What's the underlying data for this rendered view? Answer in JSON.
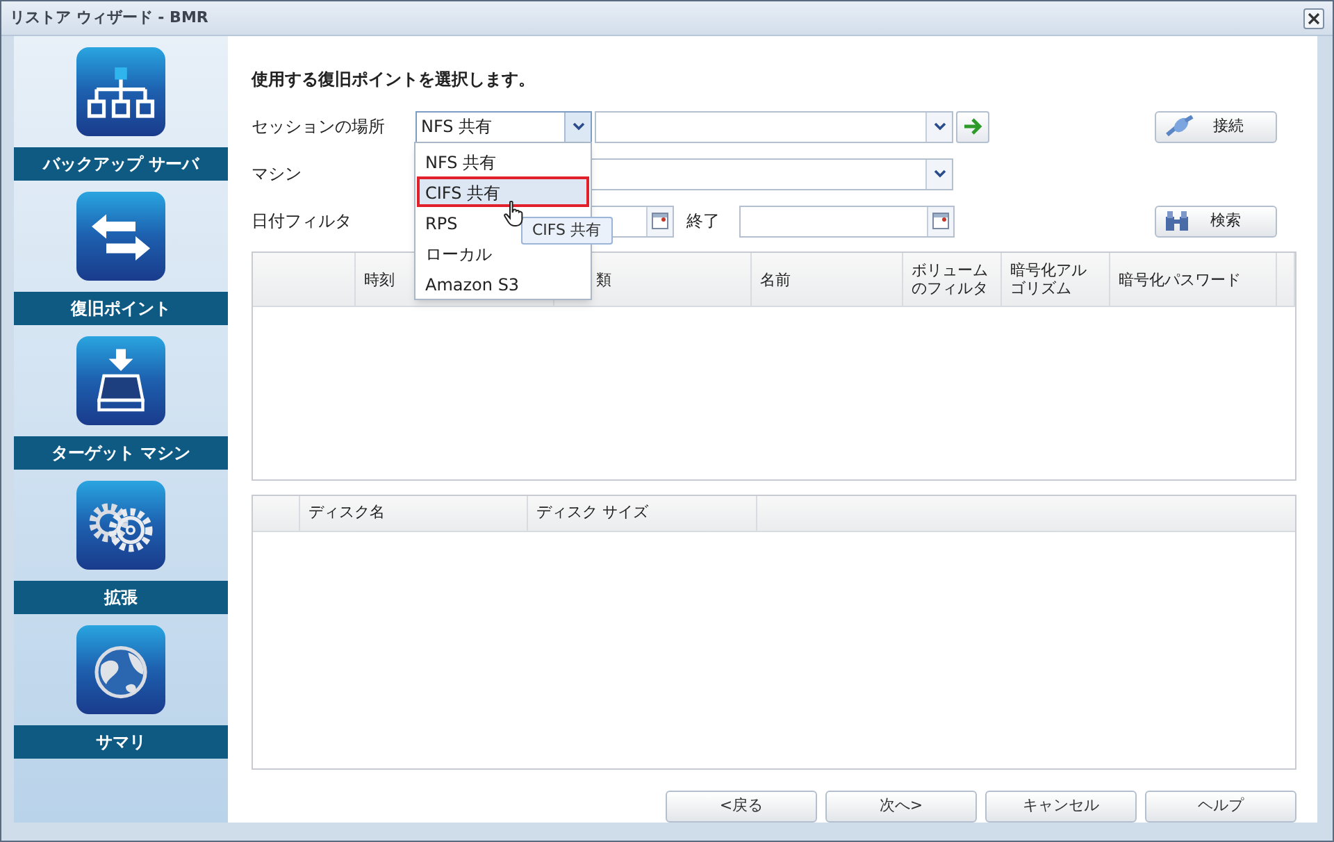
{
  "window": {
    "title": "リストア ウィザード - BMR"
  },
  "steps": [
    {
      "kind": "network",
      "label": "バックアップ サーバ"
    },
    {
      "kind": "arrows",
      "label": "復旧ポイント"
    },
    {
      "kind": "drive",
      "label": "ターゲット マシン"
    },
    {
      "kind": "gears",
      "label": "拡張"
    },
    {
      "kind": "globe",
      "label": "サマリ"
    }
  ],
  "heading": "使用する復旧ポイントを選択します。",
  "session_location": {
    "label": "セッションの場所",
    "value": "NFS 共有"
  },
  "connect_button": "接続",
  "machine": {
    "label": "マシン"
  },
  "date_filter": {
    "label": "日付フィルタ",
    "end_label": "終了"
  },
  "search_button": "検索",
  "recovery_points_table": {
    "columns": [
      "",
      "時刻",
      "類",
      "名前",
      "ボリュームのフィルタ",
      "暗号化アルゴリズム",
      "暗号化パスワード",
      ""
    ]
  },
  "disks_table": {
    "columns": [
      "",
      "ディスク名",
      "ディスク サイズ",
      ""
    ]
  },
  "location_dropdown": {
    "options": [
      {
        "label": "NFS 共有",
        "highlighted": false
      },
      {
        "label": "CIFS 共有",
        "highlighted": true
      },
      {
        "label": "RPS",
        "highlighted": false
      },
      {
        "label": "ローカル",
        "highlighted": false
      },
      {
        "label": "Amazon S3",
        "highlighted": false
      }
    ]
  },
  "tooltip": "CIFS 共有",
  "footer_buttons": [
    "<戻る",
    "次へ>",
    "キャンセル",
    "ヘルプ"
  ]
}
